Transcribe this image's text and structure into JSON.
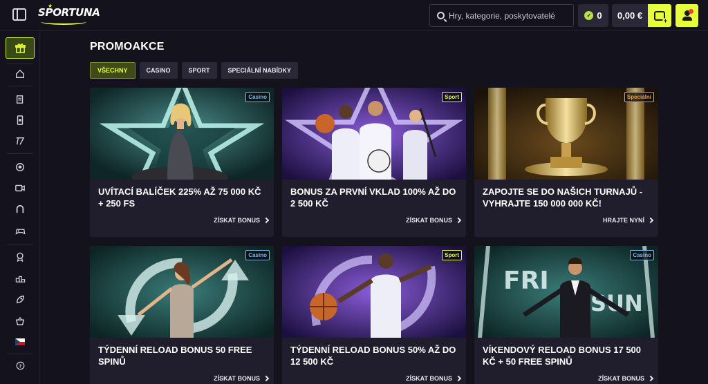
{
  "header": {
    "logo_text": "SPORTUNA",
    "search_placeholder": "Hry, kategorie, poskytovatelé",
    "coins": "0",
    "balance": "0,00 €"
  },
  "sidebar": {
    "items": [
      "gift-icon",
      "home-icon",
      "betslip-icon",
      "phone-icon",
      "slots-icon",
      "football-icon",
      "live-video-icon",
      "horseshoe-icon",
      "gamepad-icon",
      "award-icon",
      "podium-icon",
      "rocket-icon",
      "basket-icon",
      "flag-cz-icon",
      "help-icon"
    ]
  },
  "page": {
    "title": "PROMOAKCE",
    "tabs": [
      {
        "label": "VŠECHNY",
        "active": true
      },
      {
        "label": "CASINO",
        "active": false
      },
      {
        "label": "SPORT",
        "active": false
      },
      {
        "label": "SPECIÁLNÍ NABÍDKY",
        "active": false
      }
    ]
  },
  "cards": [
    {
      "badge": "Casino",
      "badge_color": "#7ab8e8",
      "title": "UVÍTACÍ BALÍČEK 225% AŽ 75 000 KČ + 250 FS",
      "cta": "ZÍSKAT BONUS"
    },
    {
      "badge": "Sport",
      "badge_color": "#e6ff3a",
      "title": "BONUS ZA PRVNÍ VKLAD 100% AŽ DO 2 500 KČ",
      "cta": "ZÍSKAT BONUS"
    },
    {
      "badge": "Speciální",
      "badge_color": "#f0a040",
      "title": "ZAPOJTE SE DO NAŠICH TURNAJŮ - VYHRAJTE 150 000 000 KČ!",
      "cta": "HRAJTE NYNÍ"
    },
    {
      "badge": "Casino",
      "badge_color": "#7ab8e8",
      "title": "TÝDENNÍ RELOAD BONUS 50 FREE SPINŮ",
      "cta": "ZÍSKAT BONUS"
    },
    {
      "badge": "Sport",
      "badge_color": "#e6ff3a",
      "title": "TÝDENNÍ RELOAD BONUS 50% AŽ DO 12 500 KČ",
      "cta": "ZÍSKAT BONUS"
    },
    {
      "badge": "Casino",
      "badge_color": "#7ab8e8",
      "title": "VÍKENDOVÝ RELOAD BONUS 17 500 KČ + 50 FREE SPINŮ",
      "cta": "ZÍSKAT BONUS"
    }
  ],
  "banner_text": {
    "fri": "FRI",
    "sun": "SUN"
  },
  "colors": {
    "accent": "#e6ff3a",
    "background": "#14121c",
    "card": "#201e2c"
  }
}
